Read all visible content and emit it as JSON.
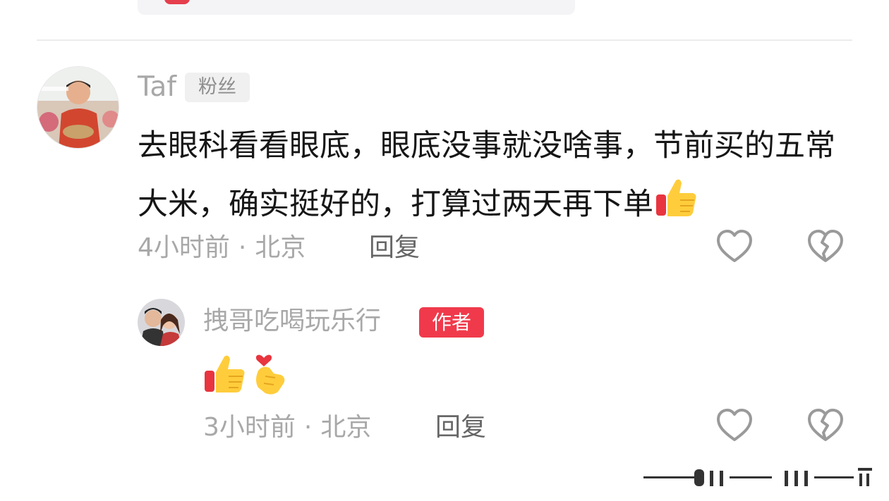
{
  "comment": {
    "username": "Taf",
    "badge": "粉丝",
    "text": "去眼科看看眼底，眼底没事就没啥事，节前买的五常大米，确实挺好的，打算过两天再下单",
    "trailing_emoji": "thumbs-up",
    "time": "4小时前",
    "separator": "·",
    "location": "北京",
    "reply_label": "回复"
  },
  "reply": {
    "username": "拽哥吃喝玩乐行",
    "badge": "作者",
    "emojis": [
      "thumbs-up",
      "finger-heart"
    ],
    "time": "3小时前",
    "separator": "·",
    "location": "北京",
    "reply_label": "回复"
  },
  "colors": {
    "author_badge": "#f03a4c",
    "meta_text": "#a8a8a8",
    "body_text": "#161616",
    "icon_stroke": "#9a9a9a"
  },
  "icons": {
    "like": "heart-outline-icon",
    "dislike": "broken-heart-icon"
  }
}
